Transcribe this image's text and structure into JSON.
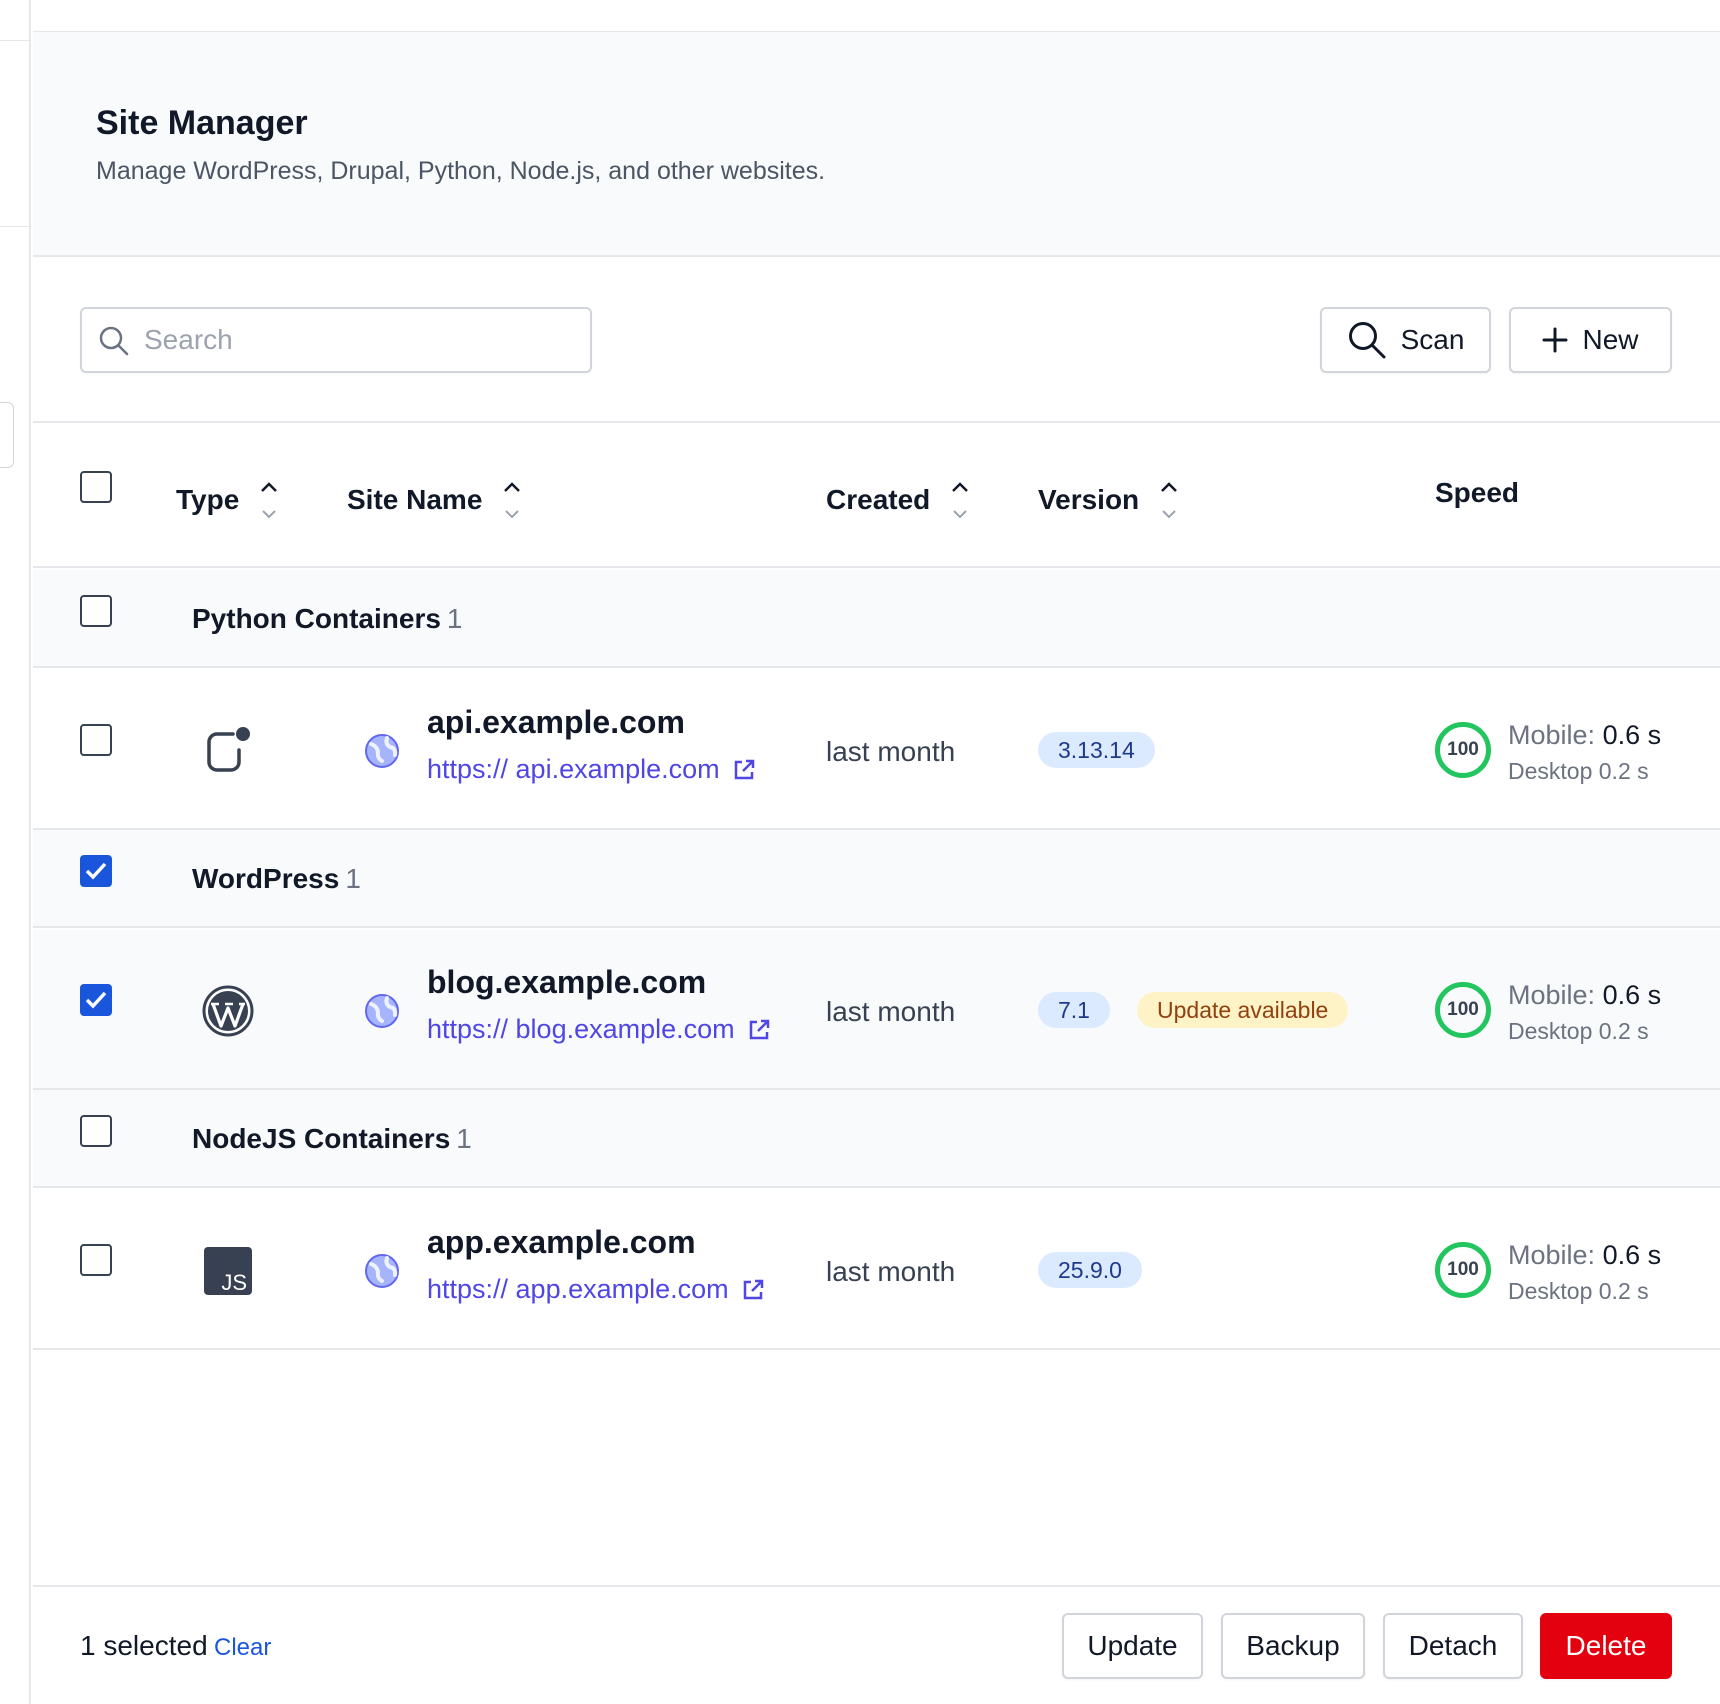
{
  "header": {
    "title": "Site Manager",
    "subtitle": "Manage WordPress, Drupal, Python, Node.js, and other websites."
  },
  "toolbar": {
    "search_placeholder": "Search",
    "search_value": "",
    "scan_label": "Scan",
    "new_label": "New"
  },
  "table": {
    "columns": [
      "Type",
      "Site Name",
      "Created",
      "Version",
      "Speed"
    ],
    "groups": [
      {
        "label": "Python Containers",
        "count": "1",
        "checked": false,
        "rows": [
          {
            "type_icon": "python-container-icon",
            "name": "api.example.com",
            "url": "https:// api.example.com",
            "created": "last month",
            "version": "3.13.14",
            "update_badge": "",
            "speed_score": "100",
            "mobile_label": "Mobile:",
            "mobile_value": "0.6 s",
            "desktop": "Desktop 0.2 s",
            "checked": false
          }
        ]
      },
      {
        "label": "WordPress",
        "count": "1",
        "checked": true,
        "rows": [
          {
            "type_icon": "wordpress-icon",
            "name": "blog.example.com",
            "url": "https:// blog.example.com",
            "created": "last month",
            "version": "7.1",
            "update_badge": "Update available",
            "speed_score": "100",
            "mobile_label": "Mobile:",
            "mobile_value": "0.6 s",
            "desktop": "Desktop 0.2 s",
            "checked": true
          }
        ]
      },
      {
        "label": "NodeJS Containers",
        "count": "1",
        "checked": false,
        "rows": [
          {
            "type_icon": "nodejs-icon",
            "type_icon_text": "JS",
            "name": "app.example.com",
            "url": "https:// app.example.com",
            "created": "last month",
            "version": "25.9.0",
            "update_badge": "",
            "speed_score": "100",
            "mobile_label": "Mobile:",
            "mobile_value": "0.6 s",
            "desktop": "Desktop 0.2 s",
            "checked": false
          }
        ]
      }
    ]
  },
  "footer": {
    "selected_text": "1 selected",
    "clear_label": "Clear",
    "update_label": "Update",
    "backup_label": "Backup",
    "detach_label": "Detach",
    "delete_label": "Delete"
  },
  "colors": {
    "primary": "#1a56db",
    "link": "#4f46e5",
    "danger": "#e3000f",
    "score_ring": "#22c55e",
    "version_badge_bg": "#dbeafe",
    "update_badge_bg": "#fef3c7"
  }
}
